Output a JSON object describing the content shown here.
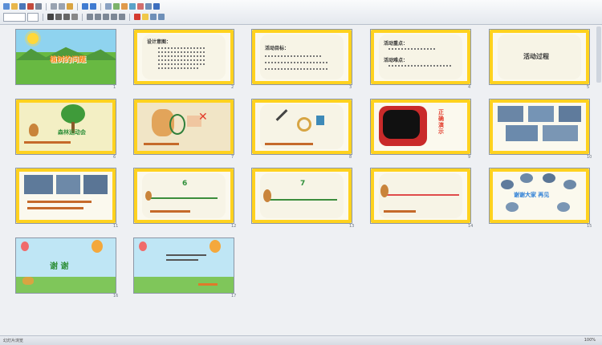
{
  "slides": [
    {
      "number": "1",
      "title": "植树的问题"
    },
    {
      "number": "2",
      "title": "设计意图："
    },
    {
      "number": "3",
      "title": "活动目标："
    },
    {
      "number": "4",
      "title": "活动重点：",
      "subtitle": "活动难点："
    },
    {
      "number": "5",
      "title": "活动过程"
    },
    {
      "number": "6",
      "title": "森林运动会"
    },
    {
      "number": "7",
      "title": ""
    },
    {
      "number": "8",
      "title": ""
    },
    {
      "number": "9",
      "title": "正确演示"
    },
    {
      "number": "10",
      "title": ""
    },
    {
      "number": "11",
      "title": ""
    },
    {
      "number": "12",
      "title": "6"
    },
    {
      "number": "13",
      "title": "7"
    },
    {
      "number": "14",
      "title": ""
    },
    {
      "number": "15",
      "title": "谢谢大家 再见"
    },
    {
      "number": "16",
      "title": "谢 谢"
    },
    {
      "number": "17",
      "title": ""
    }
  ],
  "status": {
    "left": "幻灯片浏览",
    "right": "100%"
  },
  "colors": {
    "frame": "#ffd21f",
    "accent": "#2f8f3a",
    "red": "#e23b2a"
  }
}
